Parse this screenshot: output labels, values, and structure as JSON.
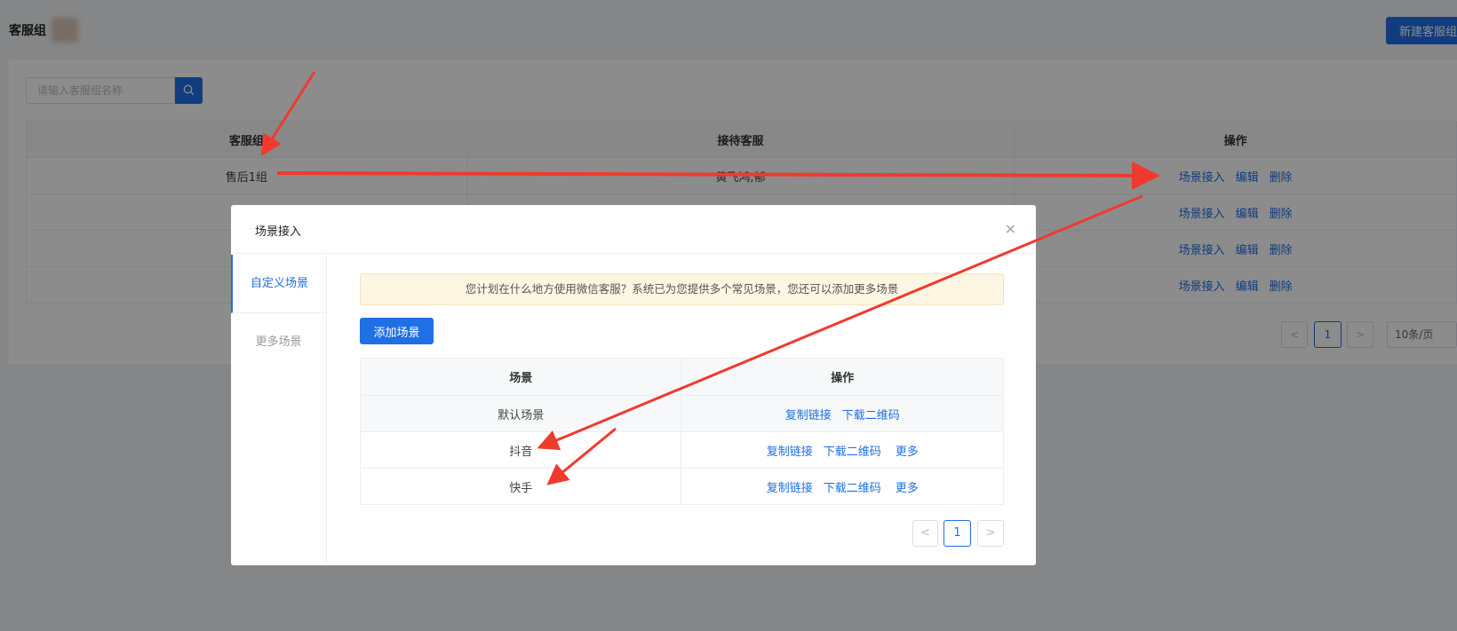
{
  "page": {
    "title": "客服组",
    "new_button": "新建客服组",
    "search_placeholder": "请输入客服组名称",
    "table": {
      "headers": [
        "客服组",
        "接待客服",
        "操作"
      ],
      "rows": [
        {
          "group": "售后1组",
          "agent": "黄飞鸿,郁"
        },
        {
          "group": "",
          "agent": ""
        },
        {
          "group": "",
          "agent": ""
        },
        {
          "group": "",
          "agent": ""
        }
      ],
      "actions": [
        "场景接入",
        "编辑",
        "删除"
      ]
    },
    "pagination": {
      "prev": "<",
      "current": "1",
      "next": ">",
      "page_size": "10条/页"
    }
  },
  "modal": {
    "title": "场景接入",
    "close": "×",
    "tabs": [
      "自定义场景",
      "更多场景"
    ],
    "notice": "您计划在什么地方使用微信客服？系统已为您提供多个常见场景，您还可以添加更多场景",
    "add_button": "添加场景",
    "table": {
      "headers": [
        "场景",
        "操作"
      ],
      "rows": [
        {
          "scene": "默认场景",
          "actions": [
            "复制链接",
            "下载二维码"
          ]
        },
        {
          "scene": "抖音",
          "actions": [
            "复制链接",
            "下载二维码",
            "更多"
          ]
        },
        {
          "scene": "快手",
          "actions": [
            "复制链接",
            "下载二维码",
            "更多"
          ]
        }
      ]
    },
    "pagination": {
      "prev": "<",
      "current": "1",
      "next": ">"
    }
  },
  "colors": {
    "primary": "#1f6fe5",
    "annotation": "#f03a2e",
    "notice_bg": "#fdf6e3"
  },
  "icons": {
    "search": "search-icon",
    "close": "close-icon",
    "chevron": "chevron-down-icon"
  }
}
